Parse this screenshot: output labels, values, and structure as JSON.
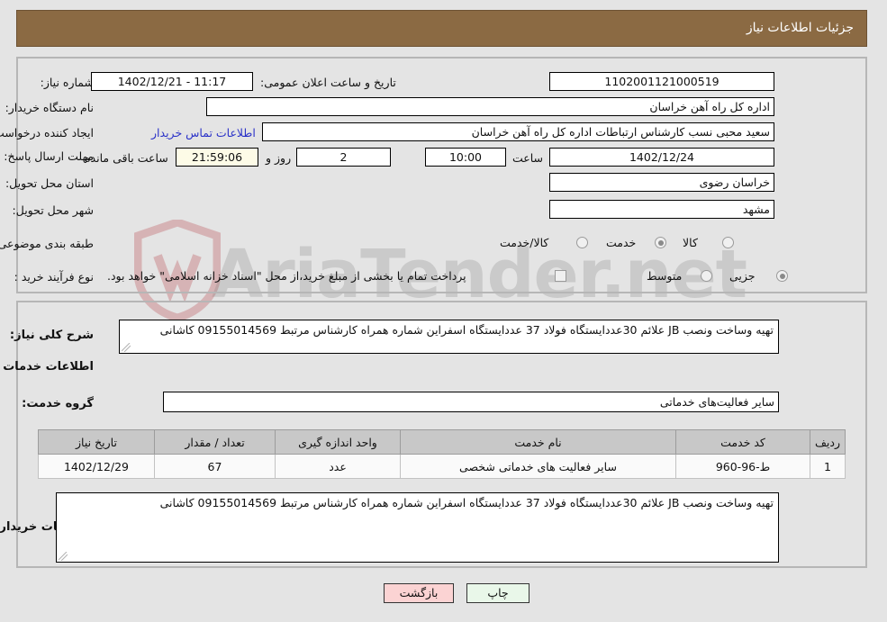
{
  "header": {
    "title": "جزئیات اطلاعات نیاز"
  },
  "top_form": {
    "need_number_label": "شماره نیاز:",
    "need_number_value": "1102001121000519",
    "public_announce_label": "تاریخ و ساعت اعلان عمومی:",
    "public_announce_value": "11:17 - 1402/12/21",
    "buyer_org_label": "نام دستگاه خریدار:",
    "buyer_org_value": "اداره کل راه آهن خراسان",
    "creator_label": "ایجاد کننده درخواست:",
    "creator_value": "سعید محبی نسب کارشناس ارتباطات اداره کل راه آهن خراسان",
    "buyer_contact_link": "اطلاعات تماس خریدار",
    "deadline_label": "مهلت ارسال پاسخ: تا تاریخ:",
    "deadline_date": "1402/12/24",
    "hour_label": "ساعت",
    "deadline_time": "10:00",
    "days_remaining": "2",
    "days_word": "روز و",
    "countdown": "21:59:06",
    "remaining_suffix": "ساعت باقی مانده",
    "province_label": "استان محل تحویل:",
    "province_value": "خراسان رضوی",
    "city_label": "شهر محل تحویل:",
    "city_value": "مشهد",
    "category_label": "طبقه بندی موضوعی:",
    "category_options": [
      "کالا",
      "خدمت",
      "کالا/خدمت"
    ],
    "category_selected": "خدمت",
    "purchase_type_label": "نوع فرآیند خرید :",
    "purchase_type_options": [
      "جزیی",
      "متوسط"
    ],
    "purchase_type_selected": "جزیی",
    "treasury_note": "پرداخت تمام یا بخشی از مبلغ خرید،از محل \"اسناد خزانه اسلامی\" خواهد بود."
  },
  "bottom_form": {
    "general_desc_label": "شرح کلی نیاز:",
    "general_desc_value": "تهیه وساخت ونصب JB علائم 30عددایستگاه فولاد 37 عددایستگاه اسفراین شماره همراه کارشناس مرتبط 09155014569 کاشانی",
    "services_section_title": "اطلاعات خدمات مورد نیاز",
    "service_group_label": "گروه خدمت:",
    "service_group_value": "سایر فعالیت‌های خدماتی",
    "buyer_notes_label": "توضیحات خریدار:",
    "buyer_notes_value": "تهیه وساخت ونصب JB علائم 30عددایستگاه فولاد 37 عددایستگاه اسفراین شماره همراه کارشناس مرتبط 09155014569 کاشانی"
  },
  "table": {
    "columns": [
      "ردیف",
      "کد خدمت",
      "نام خدمت",
      "واحد اندازه گیری",
      "تعداد / مقدار",
      "تاریخ نیاز"
    ],
    "rows": [
      {
        "row": "1",
        "code": "ط-96-960",
        "name": "سایر فعالیت های خدماتی شخصی",
        "unit": "عدد",
        "qty": "67",
        "date": "1402/12/29"
      }
    ]
  },
  "footer": {
    "print_label": "چاپ",
    "back_label": "بازگشت"
  },
  "watermark": {
    "text": "AriaTender.net"
  },
  "colors": {
    "header_bg": "#8b6a43",
    "link": "#2b32c8",
    "print_bg": "#e9f7e9",
    "back_bg": "#fbd3d3",
    "countdown_bg": "#fdfbe7",
    "table_header_bg": "#c8c8c8"
  }
}
